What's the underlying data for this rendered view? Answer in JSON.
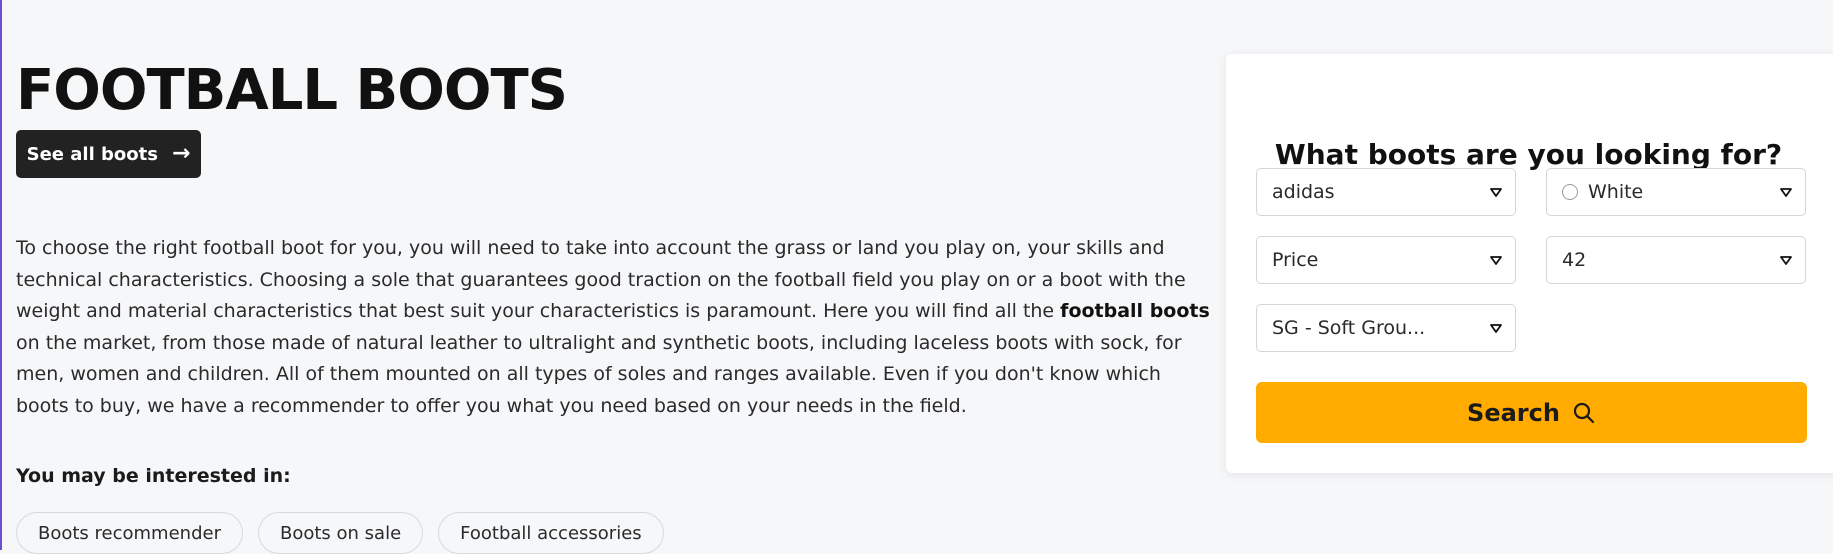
{
  "header": {
    "title": "FOOTBALL BOOTS",
    "see_all_label": "See all boots"
  },
  "description": {
    "before_bold": "To choose the right football boot for you, you will need to take into account the grass or land you play on, your skills and technical characteristics. Choosing a sole that guarantees good traction on the football field you play on or a boot with the weight and material characteristics that best suit your characteristics is paramount. Here you will find all the ",
    "bold": "football boots",
    "after_bold": " on the market, from those made of natural leather to ultralight and synthetic boots, including laceless boots with sock, for men, women and children. All of them mounted on all types of soles and ranges available. Even if you don't know which boots to buy, we have a recommender to offer you what you need based on your needs in the field."
  },
  "interested": {
    "label": "You may be interested in:",
    "links": [
      "Boots recommender",
      "Boots on sale",
      "Football accessories"
    ]
  },
  "finder": {
    "heading": "What boots are you looking for?",
    "brand": "adidas",
    "color": "White",
    "price": "Price",
    "size": "42",
    "sole": "SG - Soft Grou...",
    "search_label": "Search"
  },
  "colors": {
    "accent": "#ffab00",
    "dark_button": "#222222",
    "background": "#f6f7f9"
  },
  "icons": {
    "see_all_arrow": "arrow-right-icon",
    "select_caret": "chevron-down-icon",
    "search": "search-icon"
  }
}
